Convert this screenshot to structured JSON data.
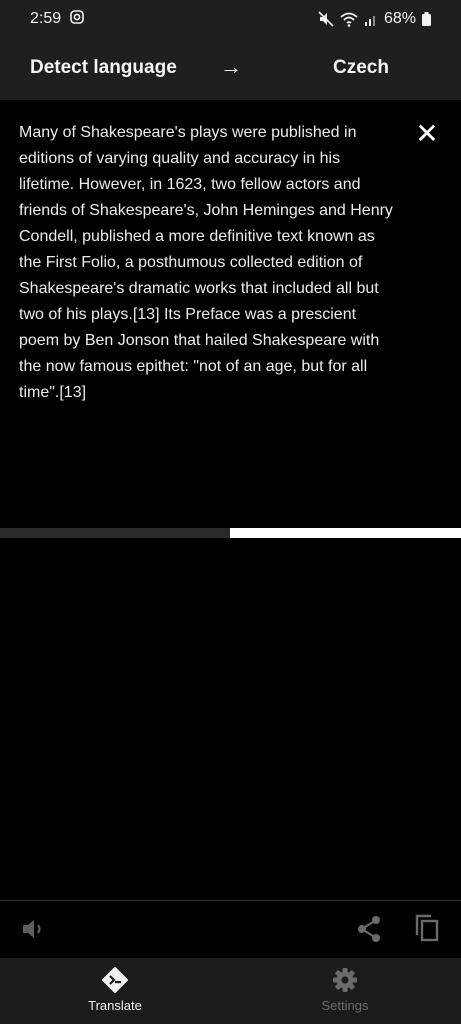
{
  "status_bar": {
    "time": "2:59",
    "battery": "68%"
  },
  "language_bar": {
    "source_language": "Detect language",
    "arrow": "→",
    "target_language": "Czech"
  },
  "input": {
    "text": "Many of Shakespeare's plays were published in editions of varying quality and accuracy in his lifetime. However, in 1623, two fellow actors and friends of Shakespeare's, John Heminges and Henry Condell, published a more definitive text known as the First Folio, a posthumous collected edition of Shakespeare's dramatic works that included all but two of his plays.[13] Its Preface was a prescient poem by Ben Jonson that hailed Shakespeare with the now famous epithet: \"not of an age, but for all time\".[13]",
    "close_glyph": "✕",
    "translation_progress": 0.5
  },
  "icons": {
    "status_left": "camera-icon",
    "status_right": [
      "mute-icon",
      "wifi-icon",
      "signal-icon",
      "battery-icon"
    ],
    "actions": [
      "speaker-icon",
      "share-icon",
      "copy-icon"
    ],
    "nav": [
      "translate-icon",
      "gear-icon"
    ]
  },
  "bottom_nav": {
    "translate_label": "Translate",
    "settings_label": "Settings"
  },
  "colors": {
    "background": "#000000",
    "bars": "#1f1f1f",
    "active_nav": "#f0f0f0",
    "inactive_nav": "#6b6b6b"
  }
}
